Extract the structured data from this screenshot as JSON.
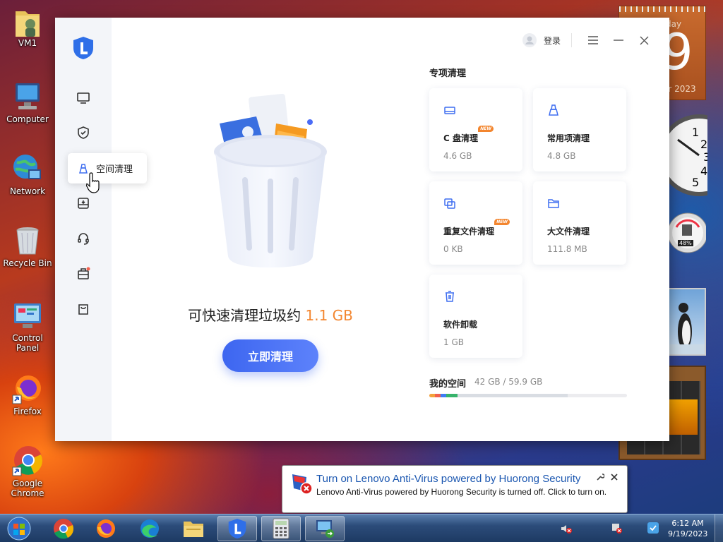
{
  "desktop": {
    "icons": [
      {
        "label": "VM1"
      },
      {
        "label": "Computer"
      },
      {
        "label": "Network"
      },
      {
        "label": "Recycle Bin"
      },
      {
        "label": "Control Panel"
      },
      {
        "label": "Firefox"
      },
      {
        "label": "Google Chrome"
      }
    ]
  },
  "gadgets": {
    "calendar_day_text": "day",
    "calendar_date": "9",
    "calendar_month_year": "er 2023",
    "meter_percent": "48%"
  },
  "app": {
    "login_label": "登录",
    "nav": {
      "tooltip": "空间清理",
      "icons": [
        "monitor-icon",
        "shield-check-icon",
        "broom-icon",
        "disk-icon",
        "headset-icon",
        "toolbox-icon",
        "bag-icon"
      ]
    },
    "main": {
      "prefix": "可快速清理垃圾约 ",
      "amount": "1.1 GB",
      "clean_button": "立即清理"
    },
    "special": {
      "title": "专项清理",
      "cards": [
        {
          "title": "C 盘清理",
          "size": "4.6 GB",
          "badge": "NEW",
          "icon": "drive-icon"
        },
        {
          "title": "常用项清理",
          "size": "4.8 GB",
          "badge": "",
          "icon": "broom-icon"
        },
        {
          "title": "重复文件清理",
          "size": "0 KB",
          "badge": "NEW",
          "icon": "copy-icon"
        },
        {
          "title": "大文件清理",
          "size": "111.8 MB",
          "badge": "",
          "icon": "folder-icon"
        },
        {
          "title": "软件卸载",
          "size": "1 GB",
          "badge": "",
          "icon": "trash-icon"
        }
      ]
    },
    "space": {
      "label": "我的空间",
      "value": "42 GB / 59.9 GB",
      "used_fraction": 0.7,
      "segments": [
        "#f3a13b",
        "#f2604e",
        "#3f7cf4",
        "#37b36b",
        "#d9dde3"
      ]
    }
  },
  "toast": {
    "title": "Turn on Lenovo Anti-Virus powered by Huorong Security",
    "body": "Lenovo Anti-Virus powered by Huorong Security is turned off. Click to turn on."
  },
  "taskbar": {
    "time": "6:12 AM",
    "date": "9/19/2023"
  },
  "colors": {
    "accent": "#4a6cf7",
    "orange": "#f3862f"
  }
}
